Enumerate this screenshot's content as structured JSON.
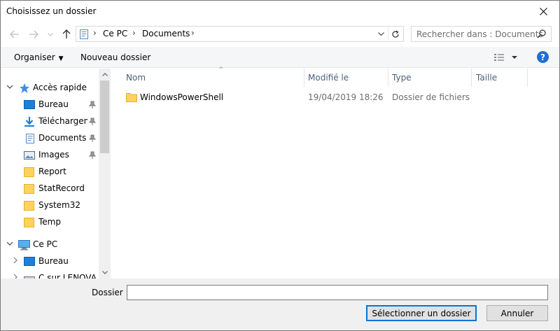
{
  "window": {
    "title": "Choisissez un dossier"
  },
  "address": {
    "crumbs": [
      "Ce PC",
      "Documents"
    ]
  },
  "search": {
    "placeholder": "Rechercher dans : Documents"
  },
  "toolbar": {
    "organize_label": "Organiser",
    "new_folder_label": "Nouveau dossier",
    "help_label": "?"
  },
  "nav": {
    "quick_access": "Accès rapide",
    "items": [
      {
        "label": "Bureau",
        "pinned": true,
        "icon": "desktop-icon"
      },
      {
        "label": "Téléchargements",
        "pinned": true,
        "icon": "download-icon"
      },
      {
        "label": "Documents",
        "pinned": true,
        "icon": "document-icon"
      },
      {
        "label": "Images",
        "pinned": true,
        "icon": "image-icon"
      },
      {
        "label": "Report",
        "pinned": false,
        "icon": "folder-icon"
      },
      {
        "label": "StatRecord",
        "pinned": false,
        "icon": "folder-icon"
      },
      {
        "label": "System32",
        "pinned": false,
        "icon": "folder-icon"
      },
      {
        "label": "Temp",
        "pinned": false,
        "icon": "folder-icon"
      }
    ],
    "this_pc": "Ce PC",
    "pc_items": [
      {
        "label": "Bureau",
        "icon": "desktop-icon"
      },
      {
        "label": "C sur LENOVA",
        "icon": "drive-icon"
      }
    ]
  },
  "columns": [
    "Nom",
    "Modifié le",
    "Type",
    "Taille"
  ],
  "files": [
    {
      "name": "WindowsPowerShell",
      "modified": "19/04/2019 18:26",
      "type": "Dossier de fichiers",
      "size": ""
    }
  ],
  "bottom": {
    "folder_label": "Dossier :",
    "folder_value": "",
    "select_label": "Sélectionner un dossier",
    "cancel_label": "Annuler"
  },
  "colors": {
    "accent": "#0078d7",
    "folder": "#ffd35b",
    "help": "#1f6fd1"
  }
}
